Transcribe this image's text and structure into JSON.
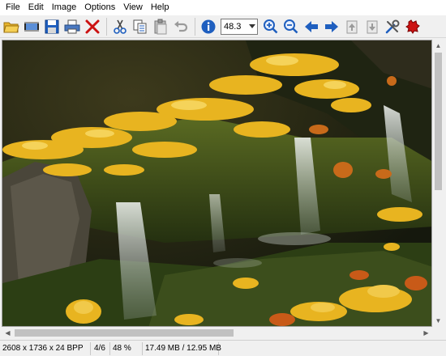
{
  "menu": [
    "File",
    "Edit",
    "Image",
    "Options",
    "View",
    "Help"
  ],
  "toolbar": {
    "zoom_value": "48.3",
    "icons": [
      "open-folder-icon",
      "slideshow-icon",
      "save-icon",
      "print-icon",
      "delete-icon",
      "cut-icon",
      "copy-icon",
      "paste-icon",
      "undo-icon",
      "info-icon",
      "zoom-in-icon",
      "zoom-out-icon",
      "previous-icon",
      "next-icon",
      "first-page-icon",
      "last-page-icon",
      "settings-icon",
      "exit-icon"
    ]
  },
  "status": {
    "dimensions": "2608 x 1736 x 24 BPP",
    "index": "4/6",
    "zoom": "48 %",
    "size": "17.49 MB / 12.95 MB"
  },
  "colors": {
    "accent_blue": "#1f5fbf",
    "delete_red": "#cc1111",
    "leaf_yellow": "#e8b420",
    "moss_green": "#4a5a22"
  }
}
